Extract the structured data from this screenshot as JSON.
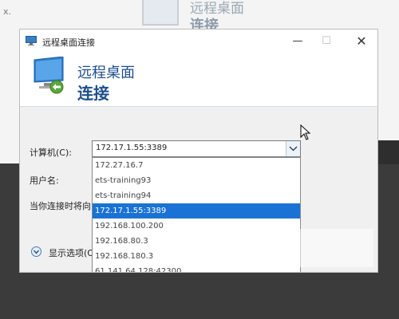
{
  "dialog": {
    "title": "远程桌面连接",
    "banner_main": "远程桌面",
    "banner_sub": "连接",
    "minimize_glyph": "—",
    "maximize_glyph": "☐",
    "close_glyph": "✕"
  },
  "background_window": {
    "title_main": "远程桌面",
    "title_sub": "连接",
    "stray_text": "x."
  },
  "form": {
    "computer_label": "计算机(C):",
    "computer_value": "172.17.1.55:3389",
    "username_label": "用户名:",
    "notice_label": "当你连接时将向",
    "show_options_label": "显示选项(O"
  },
  "dropdown": {
    "items": [
      "172.27.16.7",
      "ets-training93",
      "ets-training94",
      "172.17.1.55:3389",
      "192.168.100.200",
      "192.168.80.3",
      "192.168.180.3",
      "61.141.64.128:42300"
    ],
    "selected_index": 3
  },
  "colors": {
    "banner_text": "#1e4f8a",
    "selection": "#1a73d4"
  }
}
